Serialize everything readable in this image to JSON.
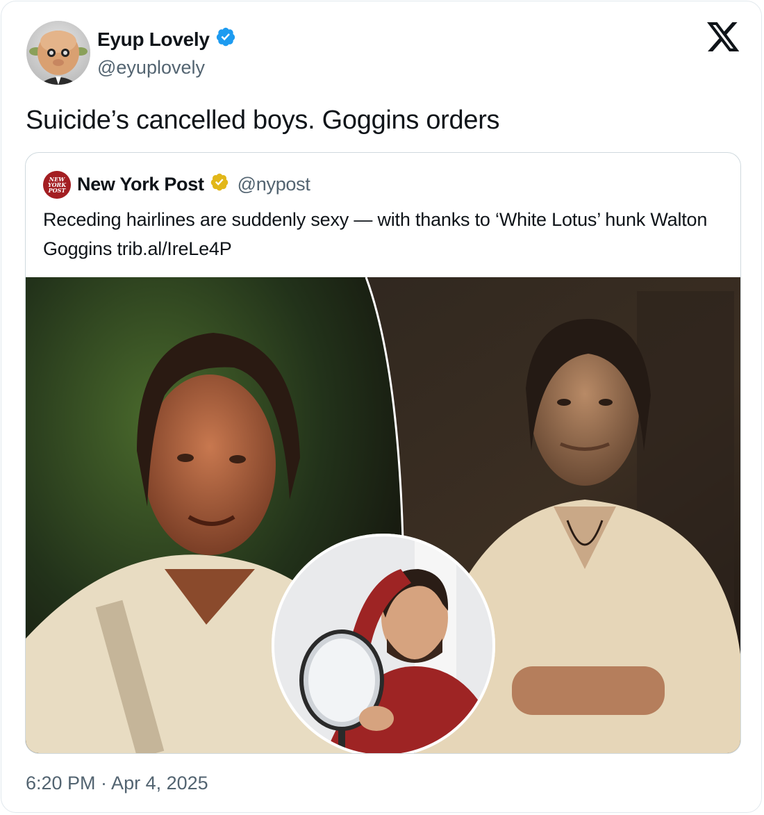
{
  "tweet": {
    "author_name": "Eyup Lovely",
    "author_handle": "@eyuplovely",
    "verified_icon": "verified-blue-badge-icon",
    "text": "Suicide’s cancelled boys. Goggins orders",
    "timestamp": "6:20 PM · Apr 4, 2025",
    "brand_icon": "x-logo-icon"
  },
  "quote": {
    "author_name": "New York Post",
    "author_handle": "@nypost",
    "verified_icon": "verified-gold-badge-icon",
    "text": "Receding hairlines are suddenly sexy — with thanks to ‘White Lotus’ hunk Walton Goggins trib.al/IreLe4P",
    "avatar_text": [
      "NEW",
      "YORK",
      "POST"
    ]
  },
  "colors": {
    "text_primary": "#0f1419",
    "text_secondary": "#536471",
    "border": "#cfd9de",
    "verified_blue": "#1d9bf0",
    "verified_gold": "#e2b719",
    "nypost_red": "#a31e22"
  }
}
